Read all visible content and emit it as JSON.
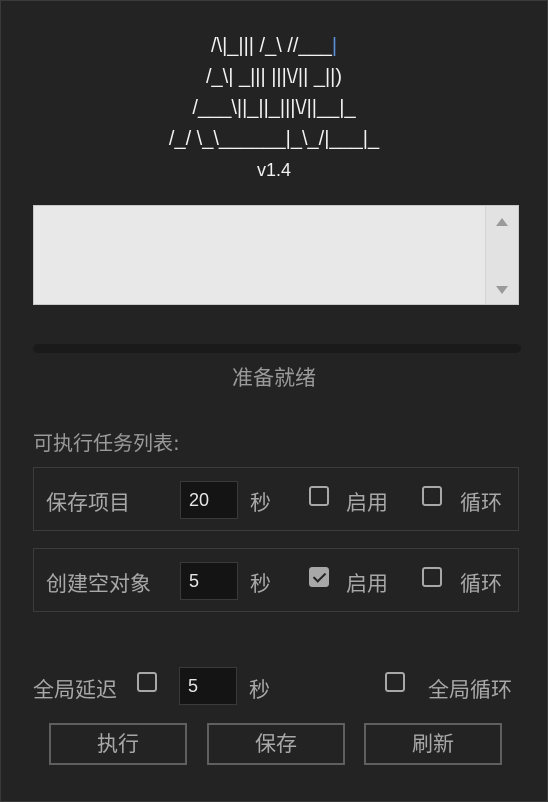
{
  "banner": {
    "lines": [
      "/\\|_||| /_\\ //___",
      "/_\\| _||| |||\\/|| _||)",
      "/___\\||_||_|||\\/||__|_",
      "/_/ \\_\\______|_\\_/|___|_"
    ],
    "version": "v1.4"
  },
  "log": {
    "value": ""
  },
  "progress": {
    "value": 0
  },
  "status": "准备就绪",
  "tasks_label": "可执行任务列表:",
  "tasks": [
    {
      "name": "保存项目",
      "interval": "20",
      "unit": "秒",
      "enable_label": "启用",
      "enabled": false,
      "loop_label": "循环",
      "loop": false
    },
    {
      "name": "创建空对象",
      "interval": "5",
      "unit": "秒",
      "enable_label": "启用",
      "enabled": true,
      "loop_label": "循环",
      "loop": false
    }
  ],
  "global": {
    "delay_label": "全局延迟",
    "delay_checked": false,
    "delay_value": "5",
    "unit": "秒",
    "loop_label": "全局循环",
    "loop_checked": false
  },
  "buttons": {
    "run": "执行",
    "save": "保存",
    "refresh": "刷新"
  },
  "colors": {
    "background": "#232323",
    "text": "#a8a8a8",
    "progress_accent": "#3a7be0"
  }
}
